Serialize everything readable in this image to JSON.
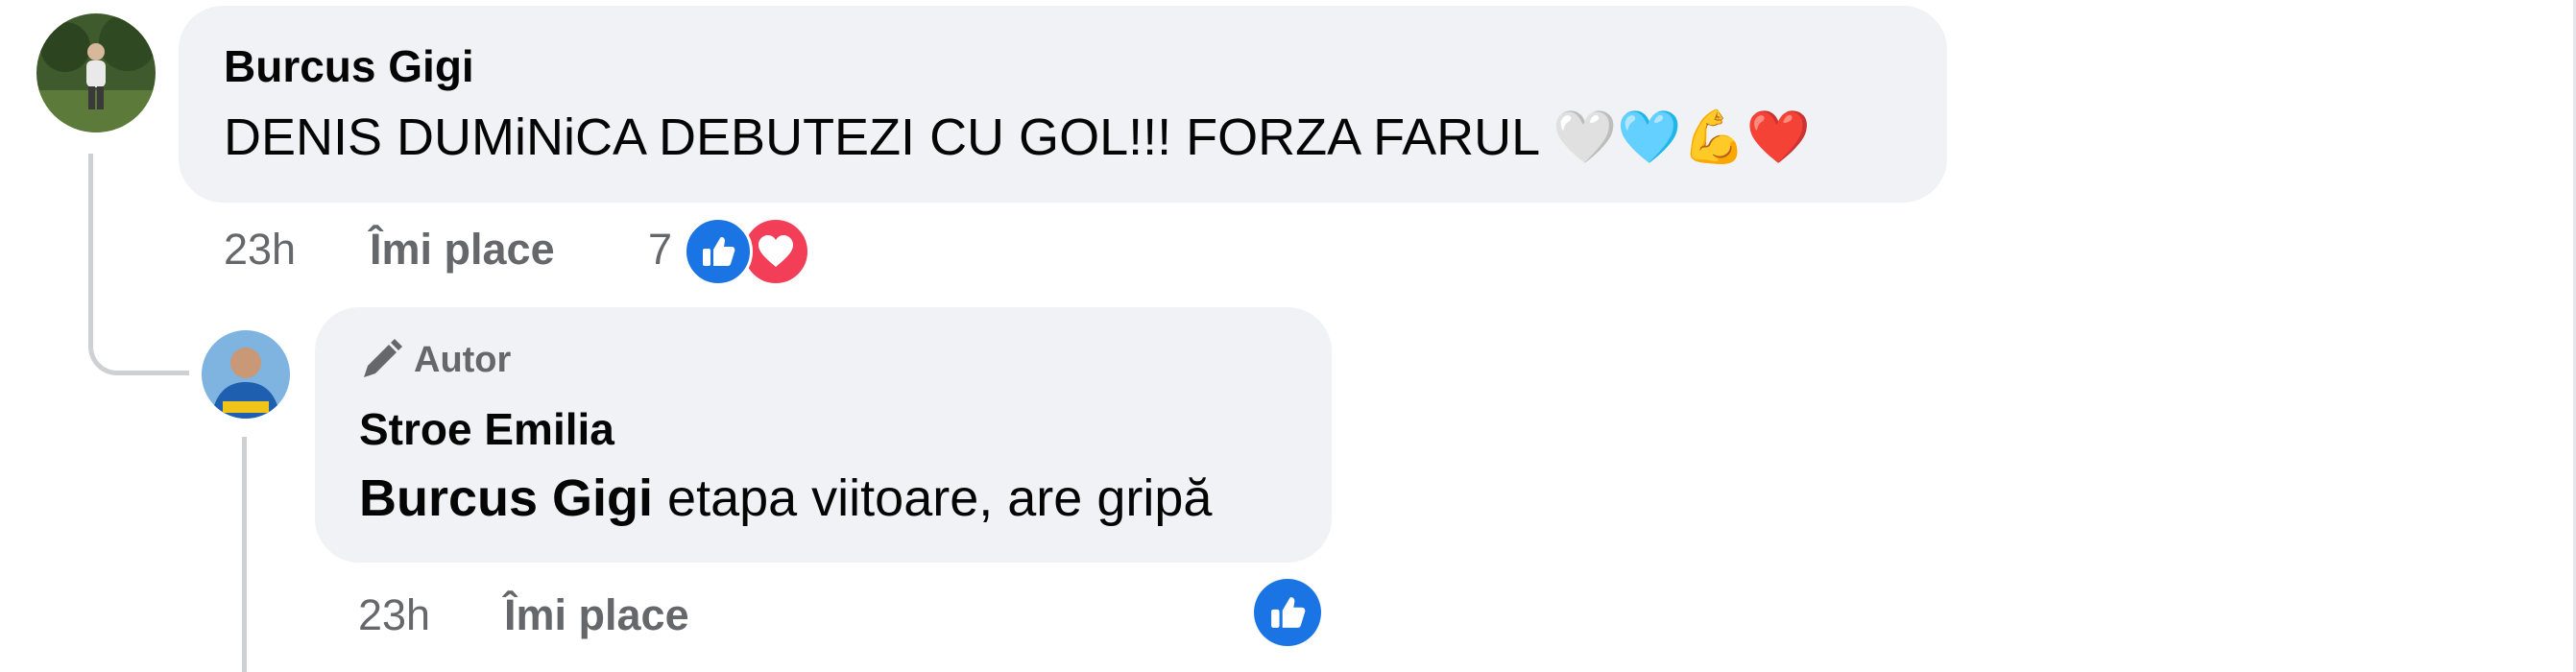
{
  "comment": {
    "author": "Burcus Gigi",
    "text": "DENIS DUMiNiCA DEBUTEZI CU GOL!!! FORZA FARUL",
    "emojis": "🤍🩵💪❤️",
    "time": "23h",
    "like_label": "Îmi place",
    "reaction_count": "7",
    "reactions": [
      "like-icon",
      "love-icon"
    ]
  },
  "reply": {
    "badge": "Autor",
    "author": "Stroe Emilia",
    "mention": "Burcus Gigi",
    "text": " etapa viitoare, are gripă",
    "time": "23h",
    "like_label": "Îmi place",
    "reactions": [
      "like-icon"
    ]
  },
  "colors": {
    "bubble": "#f0f2f5",
    "meta_text": "#65676b",
    "like_blue": "#1b74e4",
    "love_red": "#f33e58",
    "thread_line": "#ced0d4"
  }
}
